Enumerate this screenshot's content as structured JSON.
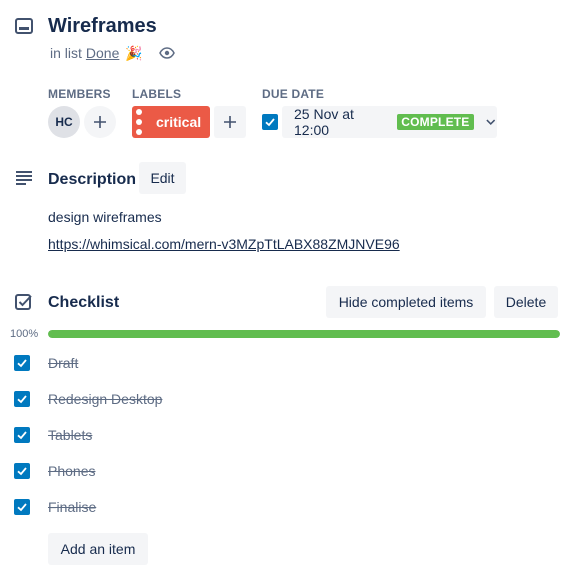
{
  "card": {
    "title": "Wireframes",
    "in_list_prefix": "in list",
    "list_name": "Done",
    "list_emoji": "🎉"
  },
  "members": {
    "label": "MEMBERS",
    "avatar_initials": "HC"
  },
  "labels": {
    "label": "LABELS",
    "items": [
      {
        "text": "critical",
        "color": "#eb5a46"
      }
    ]
  },
  "due": {
    "label": "DUE DATE",
    "date": "25 Nov at 12:00",
    "status": "COMPLETE",
    "checked": true
  },
  "description": {
    "title": "Description",
    "edit_label": "Edit",
    "text": "design wireframes",
    "link": "https://whimsical.com/mern-v3MZpTtLABX88ZMJNVE96"
  },
  "checklist": {
    "title": "Checklist",
    "hide_label": "Hide completed items",
    "delete_label": "Delete",
    "progress_percent": "100%",
    "progress_value": 100,
    "items": [
      {
        "text": "Draft",
        "checked": true
      },
      {
        "text": "Redesign Desktop",
        "checked": true
      },
      {
        "text": "Tablets",
        "checked": true
      },
      {
        "text": "Phones",
        "checked": true
      },
      {
        "text": "Finalise",
        "checked": true
      }
    ],
    "add_label": "Add an item"
  },
  "colors": {
    "accent_blue": "#0079bf",
    "success_green": "#61bd4f",
    "label_red": "#eb5a46"
  }
}
